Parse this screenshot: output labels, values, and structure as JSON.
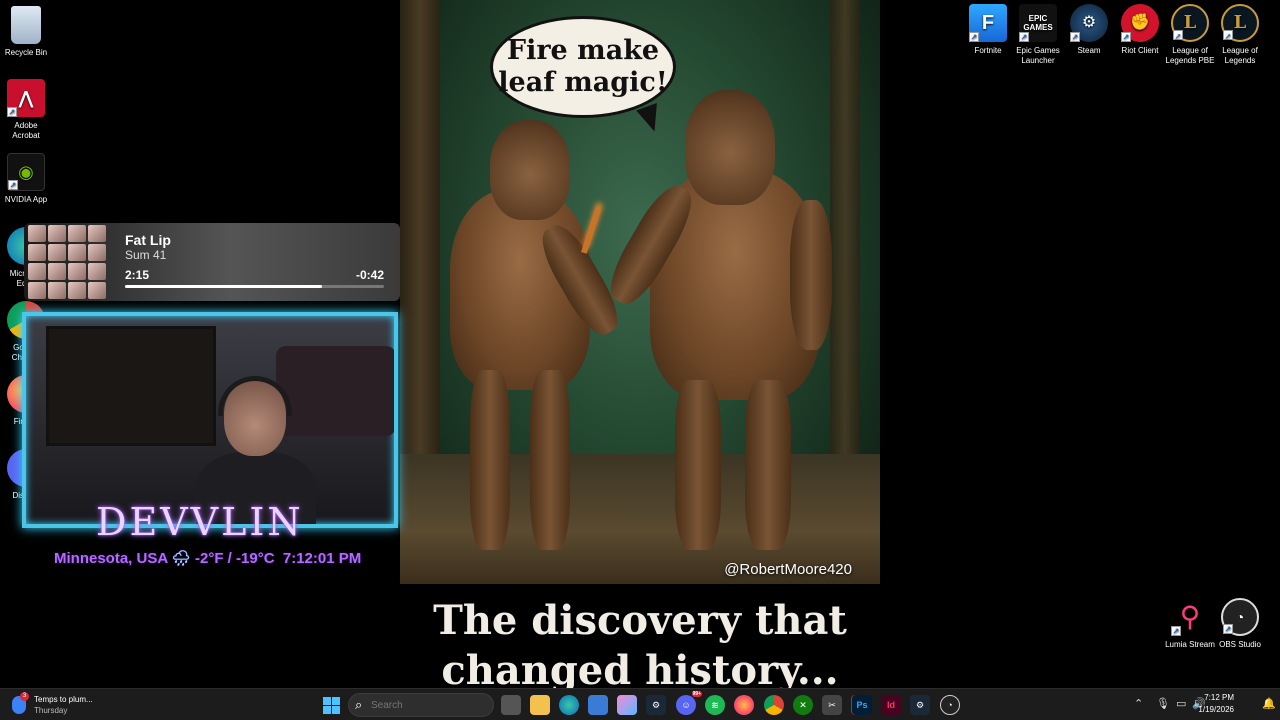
{
  "desktop_icons_left": [
    {
      "label": "Recycle Bin",
      "icon": "recycle-bin-icon"
    },
    {
      "label": "Adobe Acrobat",
      "icon": "adobe-acrobat-icon"
    },
    {
      "label": "NVIDIA App",
      "icon": "nvidia-icon"
    },
    {
      "label": "Microsoft Edge",
      "icon": "edge-icon"
    },
    {
      "label": "Google Chrome",
      "icon": "chrome-icon"
    },
    {
      "label": "Firefox",
      "icon": "firefox-icon"
    },
    {
      "label": "Discord",
      "icon": "discord-icon"
    }
  ],
  "desktop_icons_right": [
    {
      "label": "Fortnite",
      "icon": "fortnite-icon"
    },
    {
      "label": "Epic Games Launcher",
      "icon": "epic-games-icon",
      "tile_text": "EPIC GAMES"
    },
    {
      "label": "Steam",
      "icon": "steam-icon"
    },
    {
      "label": "Riot Client",
      "icon": "riot-client-icon"
    },
    {
      "label": "League of Legends PBE",
      "icon": "league-pbe-icon",
      "tile_text": "L"
    },
    {
      "label": "League of Legends",
      "icon": "league-icon",
      "tile_text": "L"
    },
    {
      "label": "Lumia Stream",
      "icon": "lumia-stream-icon"
    },
    {
      "label": "OBS Studio",
      "icon": "obs-icon"
    }
  ],
  "meme": {
    "speech": [
      "Fire make",
      "leaf magic!"
    ],
    "credit": "@RobertMoore420",
    "caption": [
      "The discovery that",
      "changed history..."
    ]
  },
  "now_playing": {
    "song": "Fat Lip",
    "artist": "Sum 41",
    "elapsed": "2:15",
    "remaining": "-0:42",
    "progress": 0.76
  },
  "overlay": {
    "brand": "DEVVLIN",
    "location": "Minnesota, USA",
    "weather_icon": "cloud-rain-icon",
    "temperature": "-2°F / -19°C",
    "time": "7:12:01 PM"
  },
  "taskbar": {
    "news_title": "Temps to plum...",
    "news_day": "Thursday",
    "news_badge": "3",
    "search_placeholder": "Search",
    "discord_badge": "99+",
    "clock_time": "7:12 PM",
    "clock_date": "1/19/2026"
  },
  "colors": {
    "overlay_accent": "#b36bff",
    "cam_border": "#49c6e8",
    "taskbar_bg": "#1c1c1c"
  }
}
